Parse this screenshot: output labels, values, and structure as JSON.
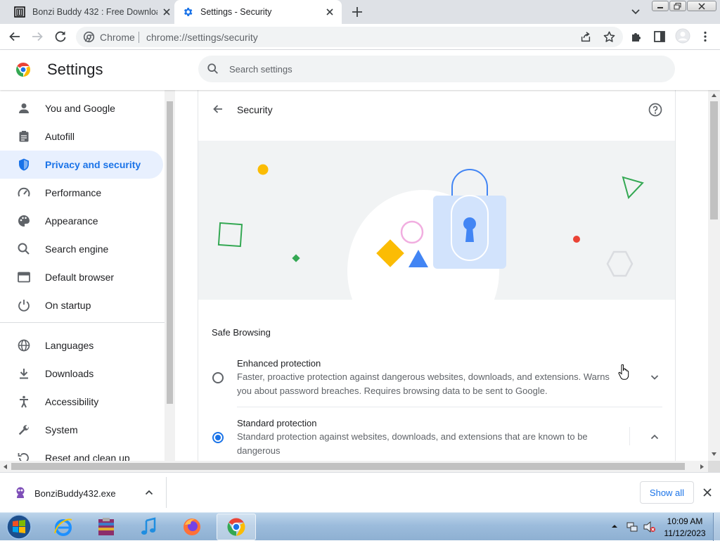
{
  "tabs": [
    {
      "title": "Bonzi Buddy 432 : Free Downloa",
      "active": false
    },
    {
      "title": "Settings - Security",
      "active": true
    }
  ],
  "toolbar": {
    "site_chip": "Chrome",
    "url": "chrome://settings/security"
  },
  "settings": {
    "title": "Settings",
    "search_placeholder": "Search settings"
  },
  "sidebar": {
    "items": [
      {
        "label": "You and Google",
        "icon": "person-icon",
        "active": false
      },
      {
        "label": "Autofill",
        "icon": "clipboard-icon",
        "active": false
      },
      {
        "label": "Privacy and security",
        "icon": "shield-icon",
        "active": true
      },
      {
        "label": "Performance",
        "icon": "speedometer-icon",
        "active": false
      },
      {
        "label": "Appearance",
        "icon": "palette-icon",
        "active": false
      },
      {
        "label": "Search engine",
        "icon": "search-icon",
        "active": false
      },
      {
        "label": "Default browser",
        "icon": "browser-window-icon",
        "active": false
      },
      {
        "label": "On startup",
        "icon": "power-icon",
        "active": false
      },
      {
        "label": "Languages",
        "icon": "globe-icon",
        "active": false
      },
      {
        "label": "Downloads",
        "icon": "download-icon",
        "active": false
      },
      {
        "label": "Accessibility",
        "icon": "accessibility-icon",
        "active": false
      },
      {
        "label": "System",
        "icon": "wrench-icon",
        "active": false
      },
      {
        "label": "Reset and clean up",
        "icon": "history-icon",
        "active": false
      }
    ]
  },
  "security": {
    "title": "Security",
    "safe_browsing_heading": "Safe Browsing",
    "options": [
      {
        "title": "Enhanced protection",
        "description": "Faster, proactive protection against dangerous websites, downloads, and extensions. Warns you about password breaches. Requires browsing data to be sent to Google.",
        "selected": false,
        "expanded": false
      },
      {
        "title": "Standard protection",
        "description": "Standard protection against websites, downloads, and extensions that are known to be dangerous",
        "selected": true,
        "expanded": true
      }
    ]
  },
  "download_bar": {
    "file_name": "BonziBuddy432.exe",
    "show_all_label": "Show all"
  },
  "taskbar": {
    "apps": [
      "internet-explorer-icon",
      "winrar-icon",
      "itunes-icon",
      "firefox-icon",
      "chrome-icon"
    ],
    "active_app": "chrome-icon",
    "time": "10:09 AM",
    "date": "11/12/2023"
  },
  "colors": {
    "accent": "#1a73e8",
    "active_nav_bg": "#e8f0fe",
    "tab_strip": "#dee1e6",
    "banner_bg": "#f1f3f4"
  }
}
